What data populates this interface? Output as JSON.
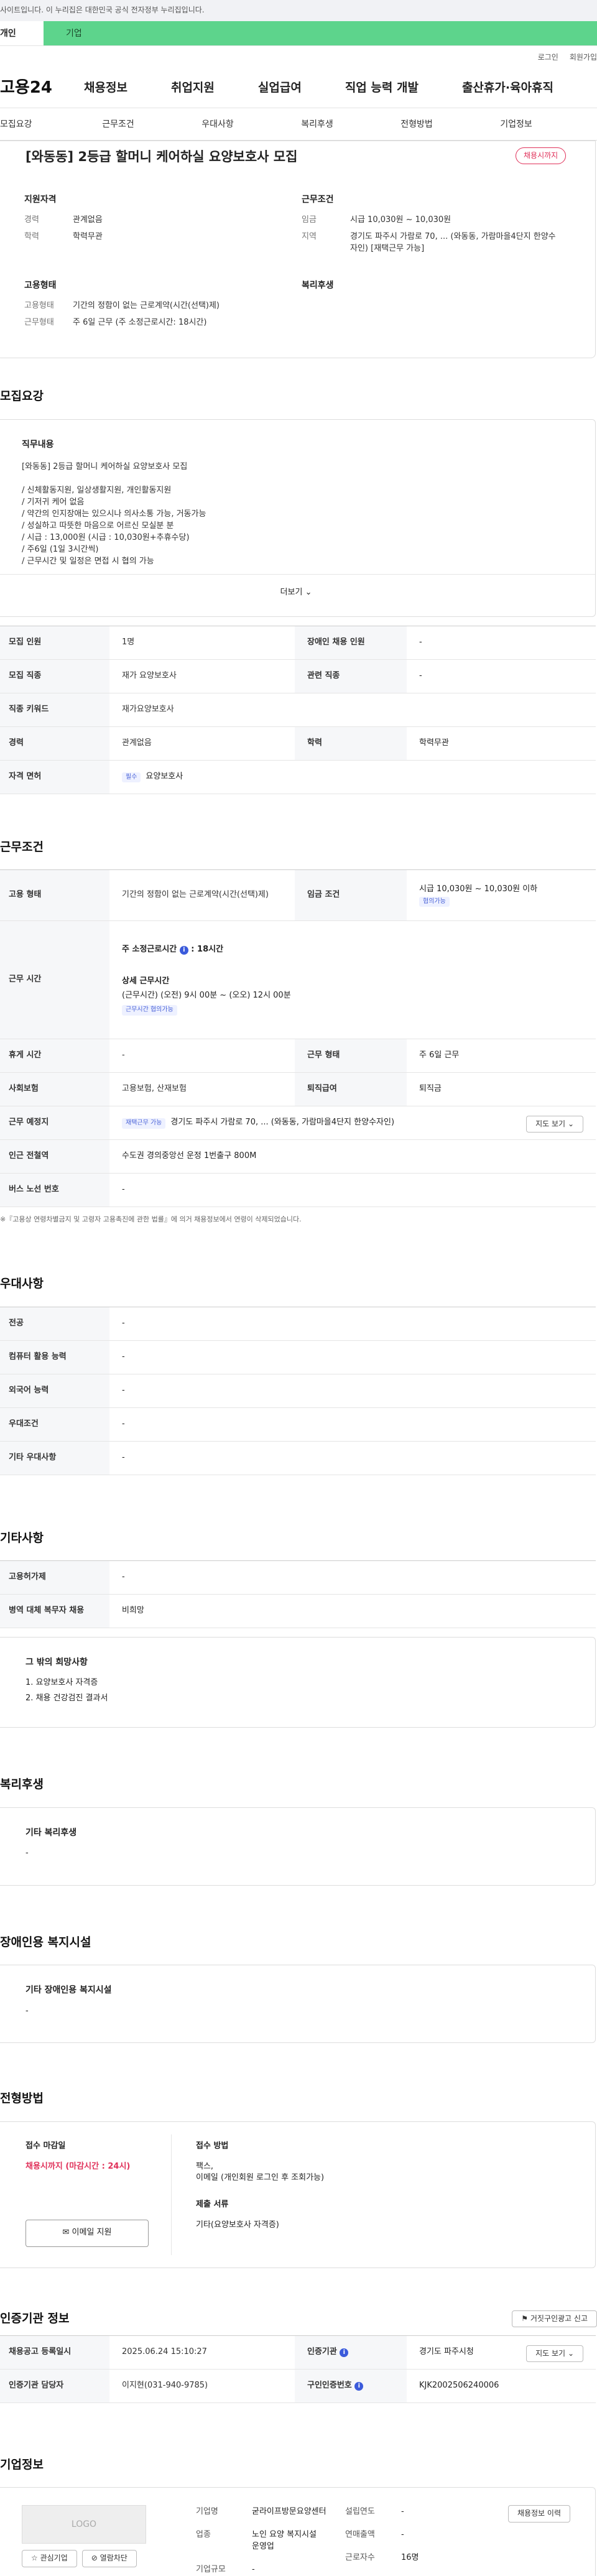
{
  "top": {
    "notice": "사이트입니다. 이 누리집은 대한민국 공식 전자정부 누리집입니다.",
    "tab_personal": "개인",
    "tab_company": "기업"
  },
  "util": {
    "login": "로그인",
    "join": "회원가입"
  },
  "gnb": {
    "logo": "고용24",
    "menus": [
      "채용정보",
      "취업지원",
      "실업급여",
      "직업 능력 개발",
      "출산휴가·육아휴직"
    ]
  },
  "subnav": [
    "모집요강",
    "근무조건",
    "우대사항",
    "복리후생",
    "전형방법",
    "기업정보"
  ],
  "header": {
    "title": "[와동동] 2등급 할머니 케어하실 요양보호사 모집",
    "badge": "채용시까지",
    "qual_title": "지원자격",
    "qual": [
      [
        "경력",
        "관계없음"
      ],
      [
        "학력",
        "학력무관"
      ]
    ],
    "cond_title": "근무조건",
    "cond": [
      [
        "임금",
        "시급 10,030원 ~ 10,030원"
      ],
      [
        "지역",
        "경기도 파주시 가람로 70, ... (와동동, 가람마을4단지 한양수자인) [재택근무 가능]"
      ]
    ],
    "emp_title": "고용형태",
    "emp": [
      [
        "고용형태",
        "기간의 정함이 없는 근로계약(시간(선택)제)"
      ],
      [
        "근무형태",
        "주 6일 근무 (주 소정근로시간: 18시간)"
      ]
    ],
    "welfare_title": "복리후생"
  },
  "recruit": {
    "title": "모집요강",
    "job_h": "직무내용",
    "job_lines": [
      "[와동동] 2등급 할머니 케어하실 요양보호사 모집",
      "",
      "/ 신체활동지원, 일상생활지원, 개인활동지원",
      "/ 기저귀 케어 없음",
      "/ 약간의 인지장애는 있으시나 의사소통 가능, 거동가능",
      "/ 성실하고 따뜻한 마음으로 어르신 모실분 분",
      "/ 시급 : 13,000원 (시급 : 10,030원+추휴수당)",
      "/ 주6일 (1일 3시간씩)",
      "/ 근무시간 및 일정은 면접 시 협의 가능"
    ],
    "more": "더보기",
    "rows": [
      [
        "모집 인원",
        "1명",
        "장애인 채용 인원",
        "-"
      ],
      [
        "모집 직종",
        "재가 요양보호사",
        "관련 직종",
        "-"
      ],
      [
        "직종 키워드",
        "재가요양보호사",
        "",
        ""
      ],
      [
        "경력",
        "관계없음",
        "학력",
        "학력무관"
      ],
      [
        "자격 면허",
        "필수",
        "요양보호사"
      ]
    ]
  },
  "work": {
    "title": "근무조건",
    "emp_type_k": "고용 형태",
    "emp_type_v": "기간의 정함이 없는 근로계약(시간(선택)제)",
    "wage_k": "임금 조건",
    "wage_v": "시급 10,030원 ~ 10,030원 이하",
    "wage_badge": "협의가능",
    "time_k": "근무 시간",
    "time_total": "주 소정근로시간",
    "time_total_v": "18시간",
    "time_detail_h": "상세 근무시간",
    "time_detail": "(근무시간) (오전) 9시 00분 ~ (오오) 12시 00분",
    "time_badge": "근무시간 협의가능",
    "rows": [
      [
        "휴게 시간",
        "-",
        "근무 형태",
        "주 6일 근무"
      ],
      [
        "사회보험",
        "고용보험, 산재보험",
        "퇴직급여",
        "퇴직금"
      ]
    ],
    "loc_k": "근무 예정지",
    "loc_badge": "재택근무 가능",
    "loc_v": "경기도 파주시 가람로 70, ... (와동동, 가람마을4단지 한양수자인)",
    "map_btn": "지도 보기",
    "station_k": "인근 전철역",
    "station_v": "수도권 경의중앙선 운정 1번출구 800M",
    "bus_k": "버스 노선 번호",
    "bus_v": "-",
    "footnote": "※『고용상 연령차별금지 및 고령자 고용촉진에 관한 법률』에 의거 채용정보에서 연령이 삭제되었습니다."
  },
  "pref": {
    "title": "우대사항",
    "rows": [
      [
        "전공",
        "-"
      ],
      [
        "컴퓨터 활용 능력",
        "-"
      ],
      [
        "외국어 능력",
        "-"
      ],
      [
        "우대조건",
        "-"
      ],
      [
        "기타 우대사항",
        "-"
      ]
    ]
  },
  "etc": {
    "title": "기타사항",
    "rows": [
      [
        "고용허가제",
        "-"
      ],
      [
        "병역 대체 복무자 채용",
        "비희망"
      ]
    ],
    "box_h": "그 밖의 희망사항",
    "box_lines": [
      "1. 요양보호사 자격증",
      "2. 채용 건강검진 결과서"
    ]
  },
  "welfare": {
    "title": "복리후생",
    "h": "기타 복리후생",
    "v": "-"
  },
  "disab": {
    "title": "장애인용 복지시설",
    "h": "기타 장애인용 복지시설",
    "v": "-"
  },
  "select": {
    "title": "전형방법",
    "deadline_h": "접수 마감일",
    "deadline_v": "채용시까지 (마감시간 : 24시)",
    "apply_btn": "이메일 지원",
    "method_h": "접수 방법",
    "method_lines": [
      "팩스,",
      "이메일 (개인회원 로그인 후 조회가능)"
    ],
    "docs_h": "제출 서류",
    "docs_v": "기타(요양보호사 자격증)"
  },
  "agency": {
    "title": "인증기관 정보",
    "report_btn": "거짓구인광고 신고",
    "rows": [
      [
        "채용공고 등록일시",
        "2025.06.24 15:10:27",
        "인증기관",
        "경기도 파주시청"
      ],
      [
        "인증기관 담당자",
        "이지현(031-940-9785)",
        "구인인증번호",
        "KJK2002506240006"
      ]
    ],
    "map_btn": "지도 보기"
  },
  "company": {
    "title": "기업정보",
    "logo": "LOGO",
    "fav_btn": "관심기업",
    "block_btn": "열람차단",
    "history_btn": "채용정보 이력",
    "name_k": "기업명",
    "name_v": "굳라이프방문요양센터",
    "ind_k": "업종",
    "ind_v": "노인 요양 복지시설 운영업",
    "size_k": "기업규모",
    "size_v": "-",
    "est_k": "설립연도",
    "est_v": "-",
    "sales_k": "연매출액",
    "sales_v": "-",
    "emp_k": "근로자수",
    "emp_v": "16명"
  }
}
